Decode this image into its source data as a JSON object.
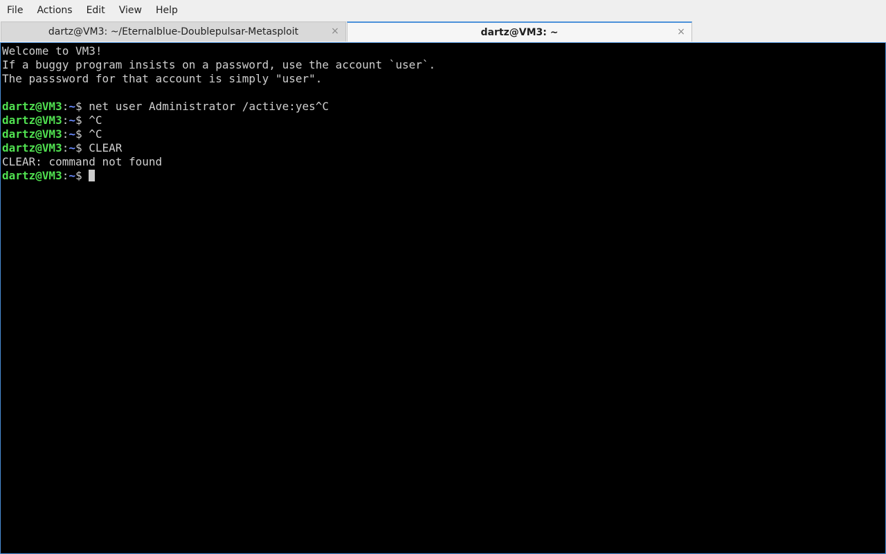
{
  "menu": {
    "items": [
      "File",
      "Actions",
      "Edit",
      "View",
      "Help"
    ]
  },
  "tabs": [
    {
      "label": "dartz@VM3: ~/Eternalblue-Doublepulsar-Metasploit",
      "close": "×",
      "active": false
    },
    {
      "label": "dartz@VM3: ~",
      "close": "×",
      "active": true
    }
  ],
  "terminal": {
    "welcome": [
      "Welcome to VM3!",
      "If a buggy program insists on a password, use the account `user`.",
      "The passsword for that account is simply \"user\".",
      ""
    ],
    "prompt": {
      "user_host": "dartz@VM3",
      "separator": ":",
      "path": "~",
      "symbol": "$"
    },
    "commands": [
      {
        "text": " net user Administrator /active:yes^C"
      },
      {
        "text": " ^C"
      },
      {
        "text": " ^C"
      },
      {
        "text": " CLEAR"
      }
    ],
    "error": "CLEAR: command not found",
    "current_input": " "
  },
  "colors": {
    "background": "#000000",
    "text": "#cfcfcf",
    "prompt_user": "#50e050",
    "prompt_path": "#6a8cff",
    "accent": "#4a90d9"
  }
}
